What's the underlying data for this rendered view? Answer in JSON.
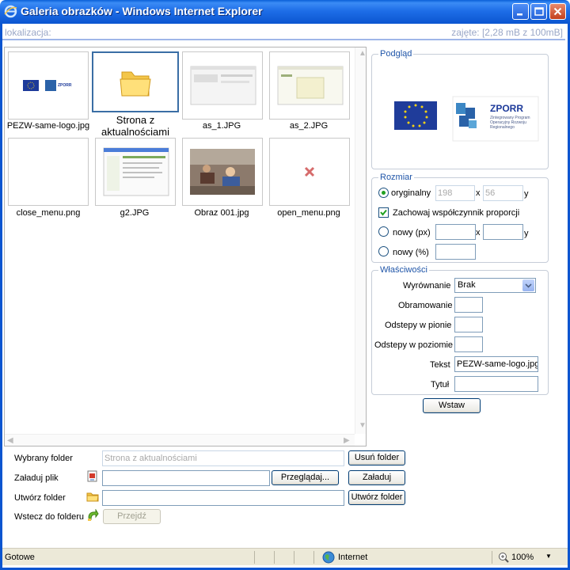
{
  "window": {
    "title": "Galeria obrazków - Windows Internet Explorer"
  },
  "location_bar": {
    "label": "lokalizacja:",
    "usage": "zajęte: [2,28 mB z 100mB]"
  },
  "files": [
    {
      "name": "PEZW-same-logo.jpg",
      "kind": "image"
    },
    {
      "name": "Strona z aktualnościami",
      "kind": "folder"
    },
    {
      "name": "as_1.JPG",
      "kind": "image"
    },
    {
      "name": "as_2.JPG",
      "kind": "image"
    },
    {
      "name": "close_menu.png",
      "kind": "image"
    },
    {
      "name": "g2.JPG",
      "kind": "image"
    },
    {
      "name": "Obraz 001.jpg",
      "kind": "image"
    },
    {
      "name": "open_menu.png",
      "kind": "image"
    }
  ],
  "preview": {
    "legend": "Podgląd",
    "logo_text": "ZPORR",
    "logo_subtext": "Zintegrowany Program Operacyjny Rozwoju Regionalnego"
  },
  "size": {
    "legend": "Rozmiar",
    "original_label": "oryginalny",
    "original_width": "198",
    "original_height": "56",
    "x_sep": "x",
    "y_label": "y",
    "keep_ratio_label": "Zachowaj współczynnik proporcji",
    "new_px_label": "nowy (px)",
    "new_pct_label": "nowy (%)"
  },
  "properties": {
    "legend": "Właściwości",
    "align_label": "Wyrównanie",
    "align_value": "Brak",
    "border_label": "Obramowanie",
    "vspace_label": "Odstepy w pionie",
    "hspace_label": "Odstepy w poziomie",
    "text_label": "Tekst",
    "text_value": "PEZW-same-logo.jpg",
    "title_label": "Tytuł"
  },
  "insert_button": "Wstaw",
  "bottom_form": {
    "selected_folder_label": "Wybrany folder",
    "selected_folder_value": "Strona z aktualnościami",
    "delete_folder_button": "Usuń folder",
    "upload_label": "Załaduj plik",
    "browse_button": "Przeglądaj...",
    "upload_button": "Załaduj",
    "create_folder_label": "Utwórz folder",
    "create_folder_button": "Utwórz folder",
    "back_label": "Wstecz do folderu",
    "go_button": "Przejdź"
  },
  "status_bar": {
    "left": "Gotowe",
    "zone": "Internet",
    "zoom": "100%"
  },
  "colors": {
    "titlebar": "#0b55d0",
    "legend": "#1f55a8",
    "status_bg": "#ece9d8"
  }
}
